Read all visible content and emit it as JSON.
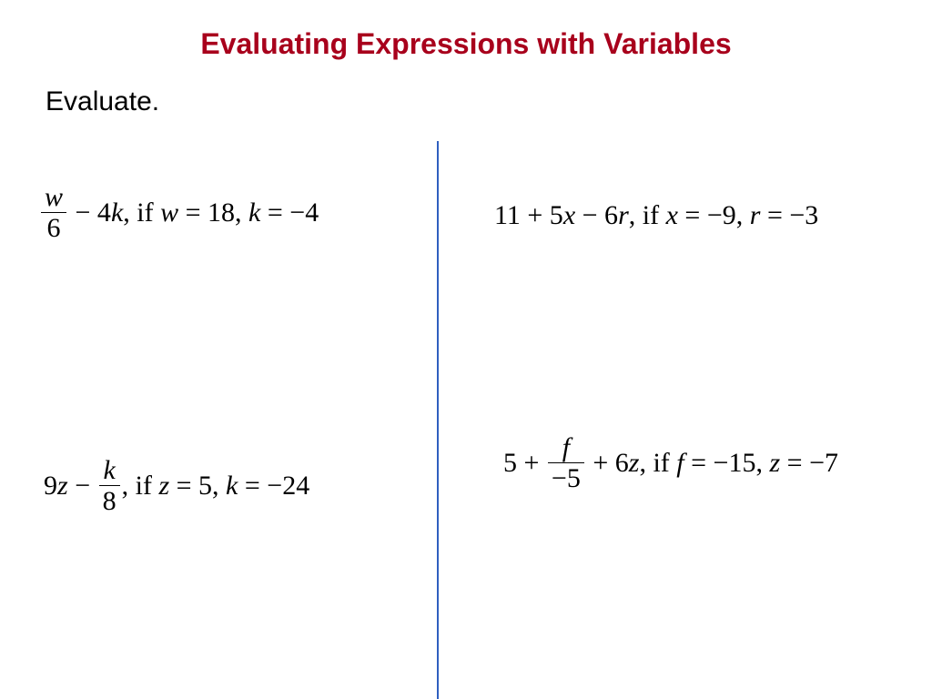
{
  "title": "Evaluating Expressions with Variables",
  "prompt": "Evaluate.",
  "problems": {
    "p1": {
      "frac_num": "w",
      "frac_den": "6",
      "after_frac": " − 4",
      "var1": "k",
      "sep": ",  if ",
      "cond1_var": "w",
      "cond1_eq": " = 18",
      "cond_sep": ", ",
      "cond2_var": "k",
      "cond2_eq": " = −4"
    },
    "p2": {
      "lead": "11 + 5",
      "var1": "x",
      "mid": " − 6",
      "var2": "r",
      "sep": ",  if ",
      "cond1_var": "x",
      "cond1_eq": " = −9",
      "cond_sep": ", ",
      "cond2_var": "r",
      "cond2_eq": " = −3"
    },
    "p3": {
      "lead": "9",
      "var1": "z",
      "mid": " − ",
      "frac_num": "k",
      "frac_den": "8",
      "sep": ",  if ",
      "cond1_var": "z",
      "cond1_eq": " = 5",
      "cond_sep": ", ",
      "cond2_var": "k",
      "cond2_eq": " = −24"
    },
    "p4": {
      "lead": "5 + ",
      "frac_num": "f",
      "frac_den": "−5",
      "after_frac": " + 6",
      "var1": "z",
      "sep": ",  if ",
      "cond1_var": "f",
      "cond1_eq": " = −15",
      "cond_sep": ",  ",
      "cond2_var": "z",
      "cond2_eq": " = −7"
    }
  }
}
